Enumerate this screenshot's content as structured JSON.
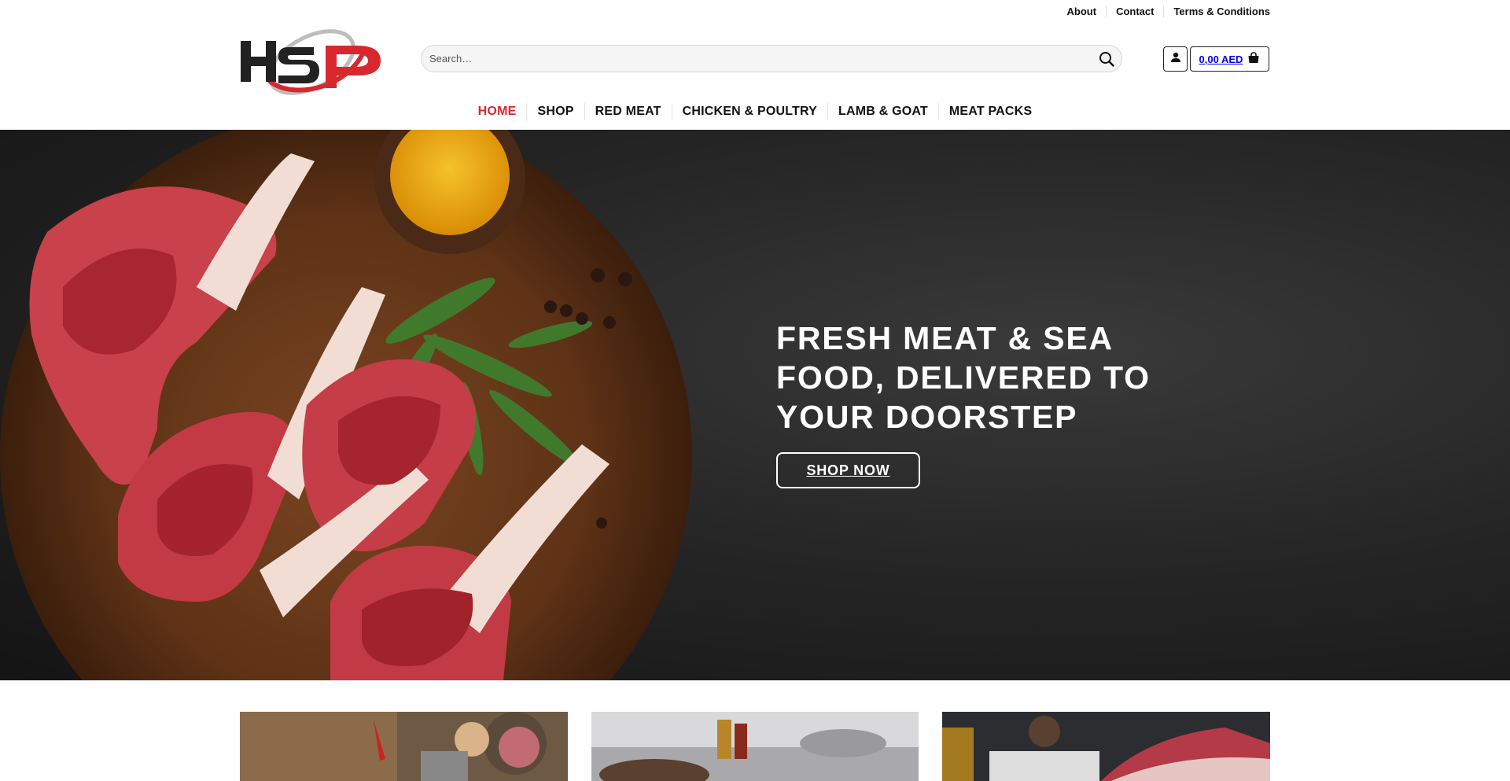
{
  "top_links": {
    "about": "About",
    "contact": "Contact",
    "terms": "Terms & Conditions"
  },
  "logo": {
    "text": "HSP"
  },
  "search": {
    "placeholder": "Search…"
  },
  "cart": {
    "total": "0,00 AED"
  },
  "nav": {
    "home": "HOME",
    "shop": "SHOP",
    "red_meat": "RED MEAT",
    "chicken": "CHICKEN & POULTRY",
    "lamb": "LAMB & GOAT",
    "packs": "MEAT PACKS"
  },
  "hero": {
    "title_line1": "FRESH MEAT & SEA",
    "title_line2": "FOOD, DELIVERED TO",
    "title_line3": "YOUR DOORSTEP",
    "cta": "SHOP NOW"
  },
  "colors": {
    "accent": "#d9272e",
    "hero_bg": "#262626",
    "board": "#6b3a1e"
  },
  "icons": [
    "search-icon",
    "user-icon",
    "shopping-bag-icon"
  ]
}
